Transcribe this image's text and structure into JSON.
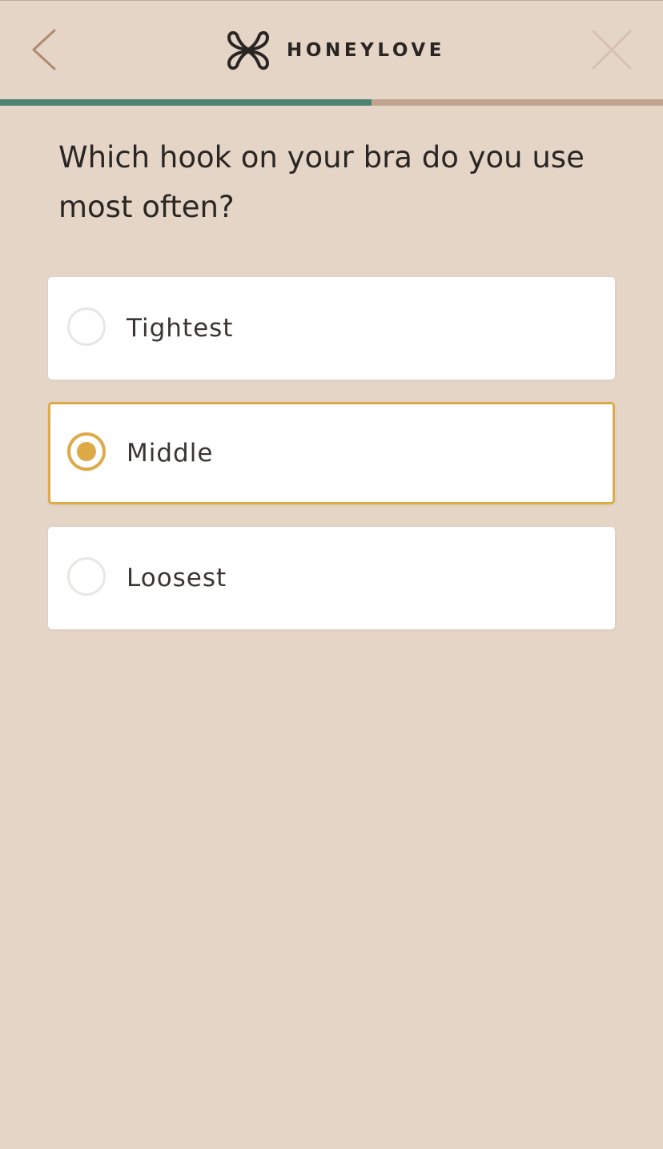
{
  "header": {
    "brand": "HONEYLOVE",
    "back_icon": "chevron-left-icon",
    "close_icon": "close-icon",
    "logo_icon": "honeylove-logo-icon"
  },
  "progress": {
    "value": 0.56
  },
  "question": {
    "text": "Which hook on your bra do you use most often?"
  },
  "options": [
    {
      "label": "Tightest",
      "selected": false
    },
    {
      "label": "Middle",
      "selected": true
    },
    {
      "label": "Loosest",
      "selected": false
    }
  ],
  "colors": {
    "background": "#e4d5c7",
    "progress_fill": "#4b8272",
    "progress_track": "#bfa38d",
    "accent": "#deaa48",
    "card": "#ffffff",
    "text": "#2b2623",
    "back_icon": "#b18a6e",
    "close_icon": "#d6c1b0"
  }
}
